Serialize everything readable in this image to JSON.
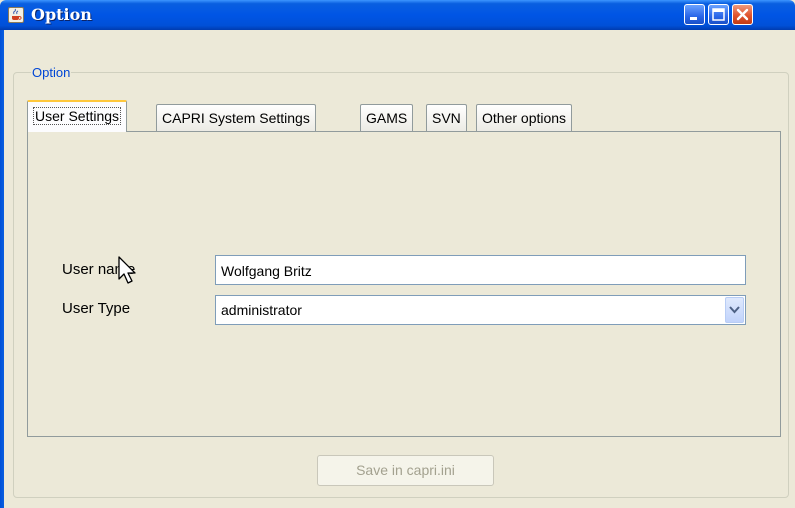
{
  "window": {
    "title": "Option",
    "icons": {
      "app": "java-cup-icon",
      "minimize": "minimize-icon",
      "maximize": "maximize-icon",
      "close": "close-icon"
    },
    "colors": {
      "titlebar": "#0055e5",
      "face": "#ece9d8",
      "close_button": "#e0542e",
      "accent_tab": "#ffc83c",
      "group_label": "#0046d5"
    }
  },
  "group": {
    "label": "Option"
  },
  "tabs": [
    {
      "label": "User Settings",
      "active": true
    },
    {
      "label": "CAPRI System Settings",
      "active": false
    },
    {
      "label": "GAMS",
      "active": false
    },
    {
      "label": "SVN",
      "active": false
    },
    {
      "label": "Other options",
      "active": false
    }
  ],
  "user_settings": {
    "user_name_label": "User name",
    "user_name_value": "Wolfgang Britz",
    "user_type_label": "User Type",
    "user_type_value": "administrator"
  },
  "footer": {
    "save_label": "Save in capri.ini",
    "save_enabled": false
  }
}
